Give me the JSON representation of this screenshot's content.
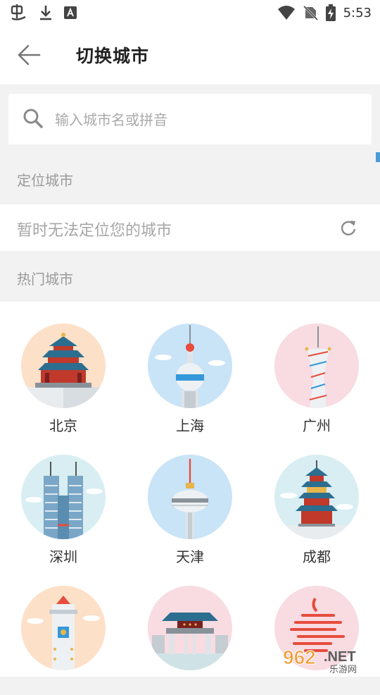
{
  "status_bar": {
    "time": "5:53"
  },
  "header": {
    "title": "切换城市",
    "back_icon": "arrow-left-icon"
  },
  "search": {
    "placeholder": "输入城市名或拼音"
  },
  "location": {
    "section_label": "定位城市",
    "message": "暂时无法定位您的城市"
  },
  "hot": {
    "section_label": "热门城市",
    "cities": [
      {
        "name": "北京",
        "bg": "#fde0c8",
        "landmark": "temple-of-heaven"
      },
      {
        "name": "上海",
        "bg": "#c9e3f7",
        "landmark": "oriental-pearl-tower"
      },
      {
        "name": "广州",
        "bg": "#f8dce2",
        "landmark": "canton-tower"
      },
      {
        "name": "深圳",
        "bg": "#d8eef2",
        "landmark": "twin-skyscrapers"
      },
      {
        "name": "天津",
        "bg": "#c9e3f7",
        "landmark": "tv-tower"
      },
      {
        "name": "成都",
        "bg": "#d8eef2",
        "landmark": "pagoda"
      },
      {
        "name": "",
        "bg": "#fde0c8",
        "landmark": "clock-tower"
      },
      {
        "name": "",
        "bg": "#f8dce2",
        "landmark": "memorial-gate"
      },
      {
        "name": "",
        "bg": "#f8dce2",
        "landmark": "red-sculpture"
      }
    ]
  },
  "watermark": {
    "brand": "962.NET",
    "sub": "乐游网"
  }
}
